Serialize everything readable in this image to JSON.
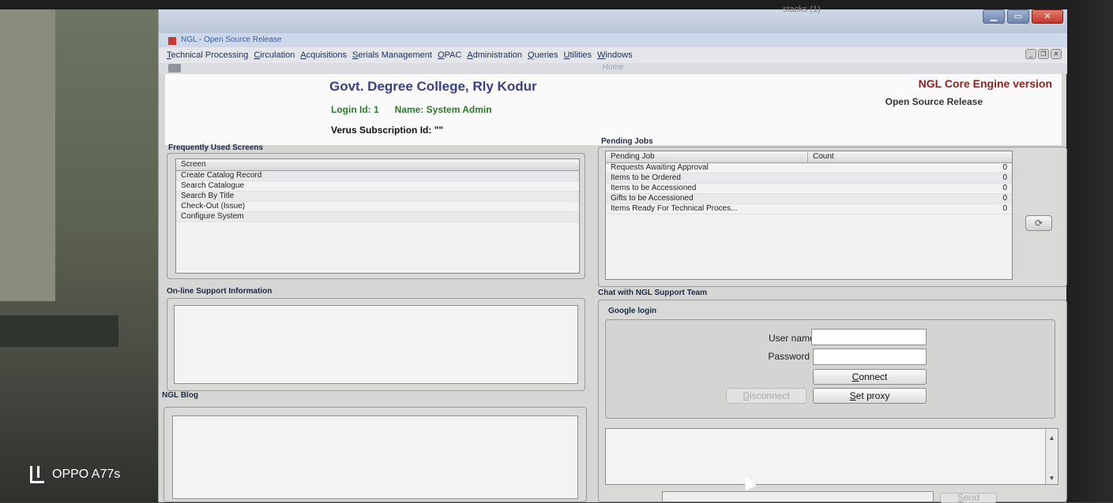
{
  "outer": {
    "caption": "stacks (1)"
  },
  "app": {
    "title": "NGL - Open Source Release",
    "menu": [
      "Technical Processing",
      "Circulation",
      "Acquisitions",
      "Serials Management",
      "OPAC",
      "Administration",
      "Queries",
      "Utilities",
      "Windows"
    ],
    "doc_title": "Home"
  },
  "header": {
    "college": "Govt. Degree College, Rly Kodur",
    "login_id": "Login Id: 1",
    "name": "Name: System Admin",
    "subscription": "Verus Subscription Id: \"\"",
    "engine": "NGL Core Engine version",
    "release": "Open Source Release"
  },
  "frequent": {
    "label": "Frequently Used Screens",
    "column": "Screen",
    "items": [
      "Create Catalog Record",
      "Search Catalogue",
      "Search By Title",
      "Check-Out (Issue)",
      "Configure System"
    ]
  },
  "pending": {
    "label": "Pending Jobs",
    "columns": [
      "Pending Job",
      "Count"
    ],
    "rows": [
      {
        "job": "Requests Awaiting Approval",
        "count": "0"
      },
      {
        "job": "Items to be Ordered",
        "count": "0"
      },
      {
        "job": "Items to be Accessioned",
        "count": "0"
      },
      {
        "job": "Gifts to be Accessioned",
        "count": "0"
      },
      {
        "job": "Items Ready For Technical Proces...",
        "count": "0"
      }
    ]
  },
  "support": {
    "label": "On-line Support Information"
  },
  "blog": {
    "label": "NGL Blog"
  },
  "chat": {
    "label": "Chat with NGL Support Team",
    "google": "Google login",
    "username_label": "User name:",
    "password_label": "Password",
    "connect": "Connect",
    "disconnect": "Disconnect",
    "proxy": "Set proxy",
    "send": "Send"
  },
  "watermark": "OPPO A77s"
}
